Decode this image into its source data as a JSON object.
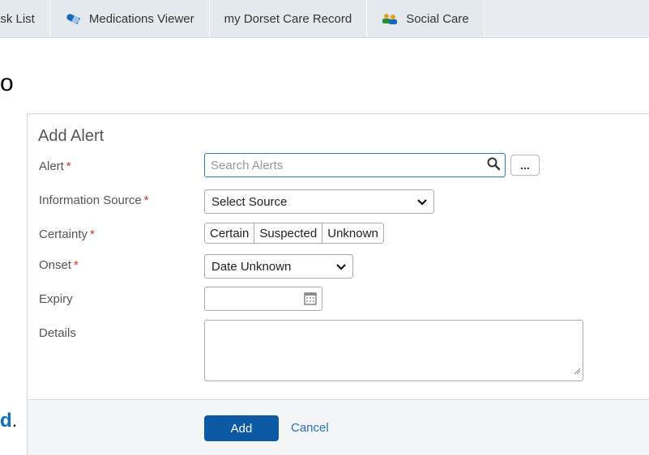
{
  "tabs": [
    {
      "label": "ask List",
      "icon": ""
    },
    {
      "label": "Medications Viewer",
      "icon": "pill-icon"
    },
    {
      "label": "my Dorset Care Record",
      "icon": ""
    },
    {
      "label": "Social Care",
      "icon": "people-icon"
    }
  ],
  "background_text": {
    "top_fragment": "o",
    "bottom_fragment": "d",
    "bottom_period": "."
  },
  "dialog": {
    "title": "Add Alert",
    "required_marker": "*",
    "fields": {
      "alert": {
        "label": "Alert",
        "placeholder": "Search Alerts",
        "more_label": "..."
      },
      "source": {
        "label": "Information Source",
        "value": "Select Source"
      },
      "certainty": {
        "label": "Certainty",
        "options": [
          "Certain",
          "Suspected",
          "Unknown"
        ]
      },
      "onset": {
        "label": "Onset",
        "value": "Date Unknown"
      },
      "expiry": {
        "label": "Expiry",
        "value": ""
      },
      "details": {
        "label": "Details",
        "value": ""
      }
    },
    "buttons": {
      "add": "Add",
      "cancel": "Cancel"
    }
  },
  "colors": {
    "primary": "#0b5aa3",
    "link": "#1f73c0",
    "required": "#c0392b",
    "focus_border": "#2f7fc0"
  }
}
